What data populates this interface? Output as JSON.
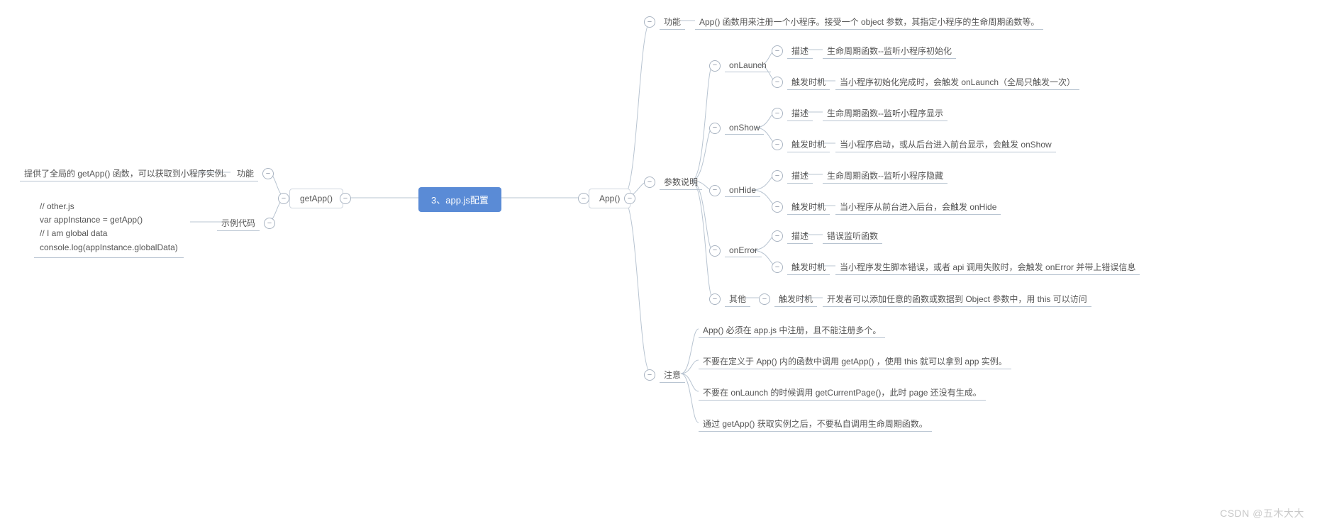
{
  "root": {
    "label": "3、app.js配置"
  },
  "common": {
    "desc": "描述",
    "timing": "触发时机"
  },
  "left": {
    "getApp": {
      "label": "getApp()",
      "children": [
        {
          "label": "功能",
          "value": "提供了全局的 getApp() 函数，可以获取到小程序实例。"
        },
        {
          "label": "示例代码",
          "value": "// other.js\nvar appInstance = getApp()\n// I am global data\nconsole.log(appInstance.globalData)"
        }
      ]
    }
  },
  "right": {
    "App": {
      "label": "App()",
      "func": {
        "label": "功能",
        "value": "App() 函数用来注册一个小程序。接受一个 object 参数，其指定小程序的生命周期函数等。"
      },
      "params": {
        "label": "参数说明",
        "items": [
          {
            "name": "onLaunch",
            "desc": "生命周期函数--监听小程序初始化",
            "timing": "当小程序初始化完成时，会触发 onLaunch（全局只触发一次）"
          },
          {
            "name": "onShow",
            "desc": "生命周期函数--监听小程序显示",
            "timing": "当小程序启动，或从后台进入前台显示，会触发 onShow"
          },
          {
            "name": "onHide",
            "desc": "生命周期函数--监听小程序隐藏",
            "timing": "当小程序从前台进入后台，会触发 onHide"
          },
          {
            "name": "onError",
            "desc": "错误监听函数",
            "timing": "当小程序发生脚本错误，或者 api 调用失败时，会触发 onError 并带上错误信息"
          }
        ],
        "other": {
          "label": "其他",
          "value": "开发者可以添加任意的函数或数据到 Object 参数中，用 this 可以访问"
        }
      },
      "notice": {
        "label": "注意",
        "items": [
          "App() 必须在 app.js 中注册，且不能注册多个。",
          "不要在定义于 App() 内的函数中调用 getApp() ，使用 this 就可以拿到 app 实例。",
          "不要在 onLaunch 的时候调用 getCurrentPage()，此时 page 还没有生成。",
          "通过 getApp() 获取实例之后，不要私自调用生命周期函数。"
        ]
      }
    }
  },
  "watermark": "CSDN @五木大大"
}
